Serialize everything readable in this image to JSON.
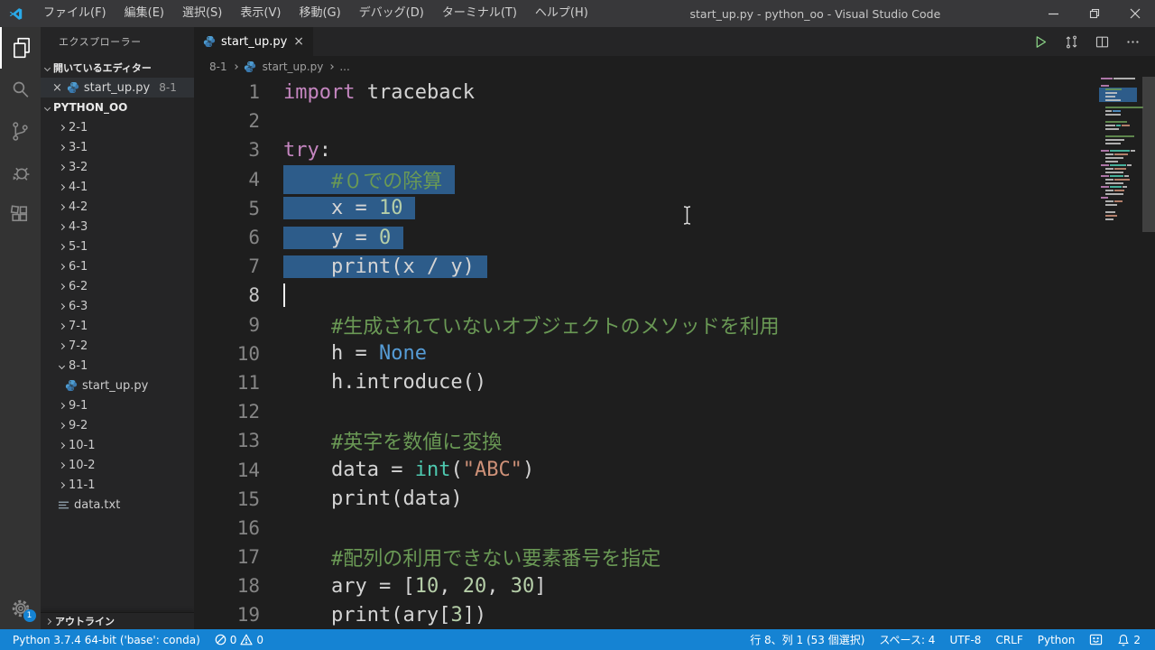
{
  "window": {
    "title": "start_up.py - python_oo - Visual Studio Code",
    "menus": [
      "ファイル(F)",
      "編集(E)",
      "選択(S)",
      "表示(V)",
      "移動(G)",
      "デバッグ(D)",
      "ターミナル(T)",
      "ヘルプ(H)"
    ]
  },
  "sidebar": {
    "title": "エクスプローラー",
    "open_editors": {
      "label": "開いているエディター",
      "close": "×",
      "file": "start_up.py",
      "badge": "8-1"
    },
    "folder_label": "PYTHON_OO",
    "tree": [
      {
        "label": "2-1",
        "kind": "dir"
      },
      {
        "label": "3-1",
        "kind": "dir"
      },
      {
        "label": "3-2",
        "kind": "dir"
      },
      {
        "label": "4-1",
        "kind": "dir"
      },
      {
        "label": "4-2",
        "kind": "dir"
      },
      {
        "label": "4-3",
        "kind": "dir"
      },
      {
        "label": "5-1",
        "kind": "dir"
      },
      {
        "label": "6-1",
        "kind": "dir"
      },
      {
        "label": "6-2",
        "kind": "dir"
      },
      {
        "label": "6-3",
        "kind": "dir"
      },
      {
        "label": "7-1",
        "kind": "dir"
      },
      {
        "label": "7-2",
        "kind": "dir"
      },
      {
        "label": "8-1",
        "kind": "dir-open"
      },
      {
        "label": "start_up.py",
        "kind": "py-file"
      },
      {
        "label": "9-1",
        "kind": "dir"
      },
      {
        "label": "9-2",
        "kind": "dir"
      },
      {
        "label": "10-1",
        "kind": "dir"
      },
      {
        "label": "10-2",
        "kind": "dir"
      },
      {
        "label": "11-1",
        "kind": "dir"
      },
      {
        "label": "data.txt",
        "kind": "txt-file"
      }
    ],
    "outline_label": "アウトライン"
  },
  "tab": {
    "file": "start_up.py",
    "close": "×"
  },
  "breadcrumb": {
    "folder": "8-1",
    "file": "start_up.py",
    "more": "..."
  },
  "editor": {
    "lines": [
      {
        "n": "1",
        "segs": [
          [
            "k",
            "import"
          ],
          [
            "p",
            " traceback"
          ]
        ]
      },
      {
        "n": "2",
        "segs": []
      },
      {
        "n": "3",
        "segs": [
          [
            "k",
            "try"
          ],
          [
            "p",
            ":"
          ]
        ]
      },
      {
        "n": "4",
        "sel": true,
        "segs": [
          [
            "c",
            "    #０での除算"
          ]
        ]
      },
      {
        "n": "5",
        "sel": true,
        "segs": [
          [
            "p",
            "    x = "
          ],
          [
            "n",
            "10"
          ]
        ]
      },
      {
        "n": "6",
        "sel": true,
        "segs": [
          [
            "p",
            "    y = "
          ],
          [
            "n",
            "0"
          ]
        ]
      },
      {
        "n": "7",
        "sel": true,
        "segs": [
          [
            "p",
            "    print(x / y)"
          ]
        ]
      },
      {
        "n": "8",
        "cursor": true,
        "segs": []
      },
      {
        "n": "9",
        "segs": [
          [
            "c",
            "    #生成されていないオブジェクトのメソッドを利用"
          ]
        ]
      },
      {
        "n": "10",
        "segs": [
          [
            "p",
            "    h = "
          ],
          [
            "b",
            "None"
          ]
        ]
      },
      {
        "n": "11",
        "segs": [
          [
            "p",
            "    h.introduce()"
          ]
        ]
      },
      {
        "n": "12",
        "segs": []
      },
      {
        "n": "13",
        "segs": [
          [
            "c",
            "    #英字を数値に変換"
          ]
        ]
      },
      {
        "n": "14",
        "segs": [
          [
            "p",
            "    data = "
          ],
          [
            "t",
            "int"
          ],
          [
            "p",
            "("
          ],
          [
            "s",
            "\"ABC\""
          ],
          [
            "p",
            ")"
          ]
        ]
      },
      {
        "n": "15",
        "segs": [
          [
            "p",
            "    print(data)"
          ]
        ]
      },
      {
        "n": "16",
        "segs": []
      },
      {
        "n": "17",
        "segs": [
          [
            "c",
            "    #配列の利用できない要素番号を指定"
          ]
        ]
      },
      {
        "n": "18",
        "segs": [
          [
            "p",
            "    ary = ["
          ],
          [
            "n",
            "10"
          ],
          [
            "p",
            ", "
          ],
          [
            "n",
            "20"
          ],
          [
            "p",
            ", "
          ],
          [
            "n",
            "30"
          ],
          [
            "p",
            "]"
          ]
        ]
      },
      {
        "n": "19",
        "segs": [
          [
            "p",
            "    print(ary["
          ],
          [
            "n",
            "3"
          ],
          [
            "p",
            "])"
          ]
        ]
      }
    ]
  },
  "minimap": {
    "sel_rows": [
      4,
      7
    ],
    "rows": [
      [
        0,
        [
          [
            "pu",
            13
          ],
          [
            "wh",
            24
          ]
        ]
      ],
      [
        0,
        []
      ],
      [
        0,
        [
          [
            "pu",
            9
          ]
        ]
      ],
      [
        5,
        [
          [
            "gr",
            18
          ]
        ]
      ],
      [
        5,
        [
          [
            "wh",
            13
          ]
        ]
      ],
      [
        5,
        [
          [
            "wh",
            11
          ]
        ]
      ],
      [
        5,
        [
          [
            "wh",
            17
          ]
        ]
      ],
      [
        0,
        []
      ],
      [
        5,
        [
          [
            "gr",
            42
          ]
        ]
      ],
      [
        5,
        [
          [
            "wh",
            7
          ],
          [
            "bl",
            9
          ]
        ]
      ],
      [
        5,
        [
          [
            "wh",
            17
          ]
        ]
      ],
      [
        0,
        []
      ],
      [
        5,
        [
          [
            "gr",
            24
          ]
        ]
      ],
      [
        5,
        [
          [
            "wh",
            11
          ],
          [
            "te",
            5
          ],
          [
            "or",
            9
          ]
        ]
      ],
      [
        5,
        [
          [
            "wh",
            15
          ]
        ]
      ],
      [
        0,
        []
      ],
      [
        5,
        [
          [
            "gr",
            32
          ]
        ]
      ],
      [
        5,
        [
          [
            "wh",
            21
          ]
        ]
      ],
      [
        5,
        [
          [
            "wh",
            17
          ]
        ]
      ],
      [
        0,
        []
      ],
      [
        0,
        [
          [
            "pu",
            9
          ],
          [
            "te",
            22
          ],
          [
            "wh",
            5
          ]
        ]
      ],
      [
        5,
        [
          [
            "wh",
            9
          ],
          [
            "or",
            15
          ]
        ]
      ],
      [
        5,
        [
          [
            "wh",
            20
          ]
        ]
      ],
      [
        5,
        [
          [
            "wh",
            14
          ]
        ]
      ],
      [
        0,
        [
          [
            "pu",
            9
          ],
          [
            "te",
            18
          ],
          [
            "wh",
            5
          ]
        ]
      ],
      [
        5,
        [
          [
            "wh",
            9
          ],
          [
            "or",
            13
          ]
        ]
      ],
      [
        5,
        [
          [
            "wh",
            20
          ]
        ]
      ],
      [
        0,
        [
          [
            "pu",
            9
          ],
          [
            "te",
            15
          ],
          [
            "wh",
            5
          ]
        ]
      ],
      [
        5,
        [
          [
            "wh",
            9
          ],
          [
            "or",
            17
          ]
        ]
      ],
      [
        5,
        [
          [
            "wh",
            20
          ]
        ]
      ],
      [
        0,
        [
          [
            "pu",
            9
          ],
          [
            "te",
            13
          ],
          [
            "wh",
            5
          ]
        ]
      ],
      [
        5,
        [
          [
            "wh",
            9
          ],
          [
            "or",
            11
          ]
        ]
      ],
      [
        5,
        [
          [
            "wh",
            20
          ]
        ]
      ],
      [
        0,
        [
          [
            "pu",
            8
          ]
        ]
      ],
      [
        5,
        [
          [
            "wh",
            9
          ],
          [
            "or",
            9
          ]
        ]
      ],
      [
        5,
        [
          [
            "wh",
            13
          ]
        ]
      ],
      [
        0,
        []
      ],
      [
        5,
        [
          [
            "wh",
            11
          ]
        ]
      ],
      [
        5,
        [
          [
            "or",
            13
          ]
        ]
      ],
      [
        5,
        [
          [
            "wh",
            9
          ]
        ]
      ]
    ]
  },
  "statusbar": {
    "interpreter": "Python 3.7.4 64-bit ('base': conda)",
    "errors": "0",
    "warnings": "0",
    "line_col": "行 8、列 1 (53 個選択)",
    "spaces": "スペース: 4",
    "encoding": "UTF-8",
    "eol": "CRLF",
    "language": "Python",
    "notifications": "2"
  },
  "colors": {
    "statusbar_bg": "#1583d3",
    "selection": "#2d5c8a",
    "comment": "#6A9955",
    "keyword": "#C586C0",
    "number": "#B5CEA8",
    "string": "#CE9178",
    "type": "#4EC9B0",
    "constant": "#569CD6"
  }
}
